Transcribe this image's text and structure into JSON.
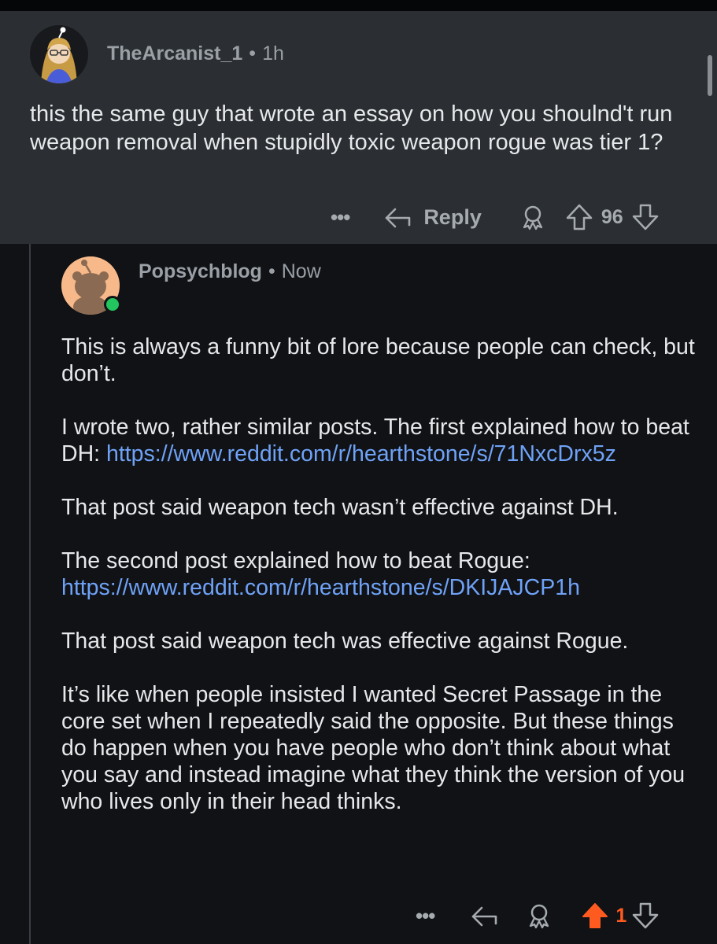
{
  "parent_comment": {
    "username": "TheArcanist_1",
    "separator": "•",
    "timestamp": "1h",
    "body": "this the same guy that wrote an essay on how you shoulnd't run weapon removal when stupidly toxic weapon rogue was tier 1?",
    "actions": {
      "more": "•••",
      "reply_label": "Reply",
      "vote_count": "96"
    }
  },
  "reply_comment": {
    "username": "Popsychblog",
    "separator": "•",
    "timestamp": "Now",
    "p1": "This is always a funny bit of lore because people can check, but don’t.",
    "p2_text": "I wrote two, rather similar posts. The first explained how to beat DH: ",
    "p2_link": "https://www.reddit.com/r/hearthstone/s/71NxcDrx5z",
    "p3": "That post said weapon tech wasn’t effective against DH.",
    "p4_text": "The second post explained how to beat Rogue: ",
    "p4_link": "https://www.reddit.com/r/hearthstone/s/DKIJAJCP1h",
    "p5": "That post said weapon tech was effective against Rogue.",
    "p6": "It’s like when people insisted I wanted Secret Passage in the core set when I repeatedly said the opposite. But these things do happen when you have people who don’t think about what you say and instead imagine what they think the version of you who lives only in their head thinks.",
    "actions": {
      "more": "•••",
      "vote_count": "1"
    }
  },
  "colors": {
    "accent_link": "#6fa2f7",
    "upvote_active": "#ff5a1f",
    "online": "#22c55e"
  }
}
